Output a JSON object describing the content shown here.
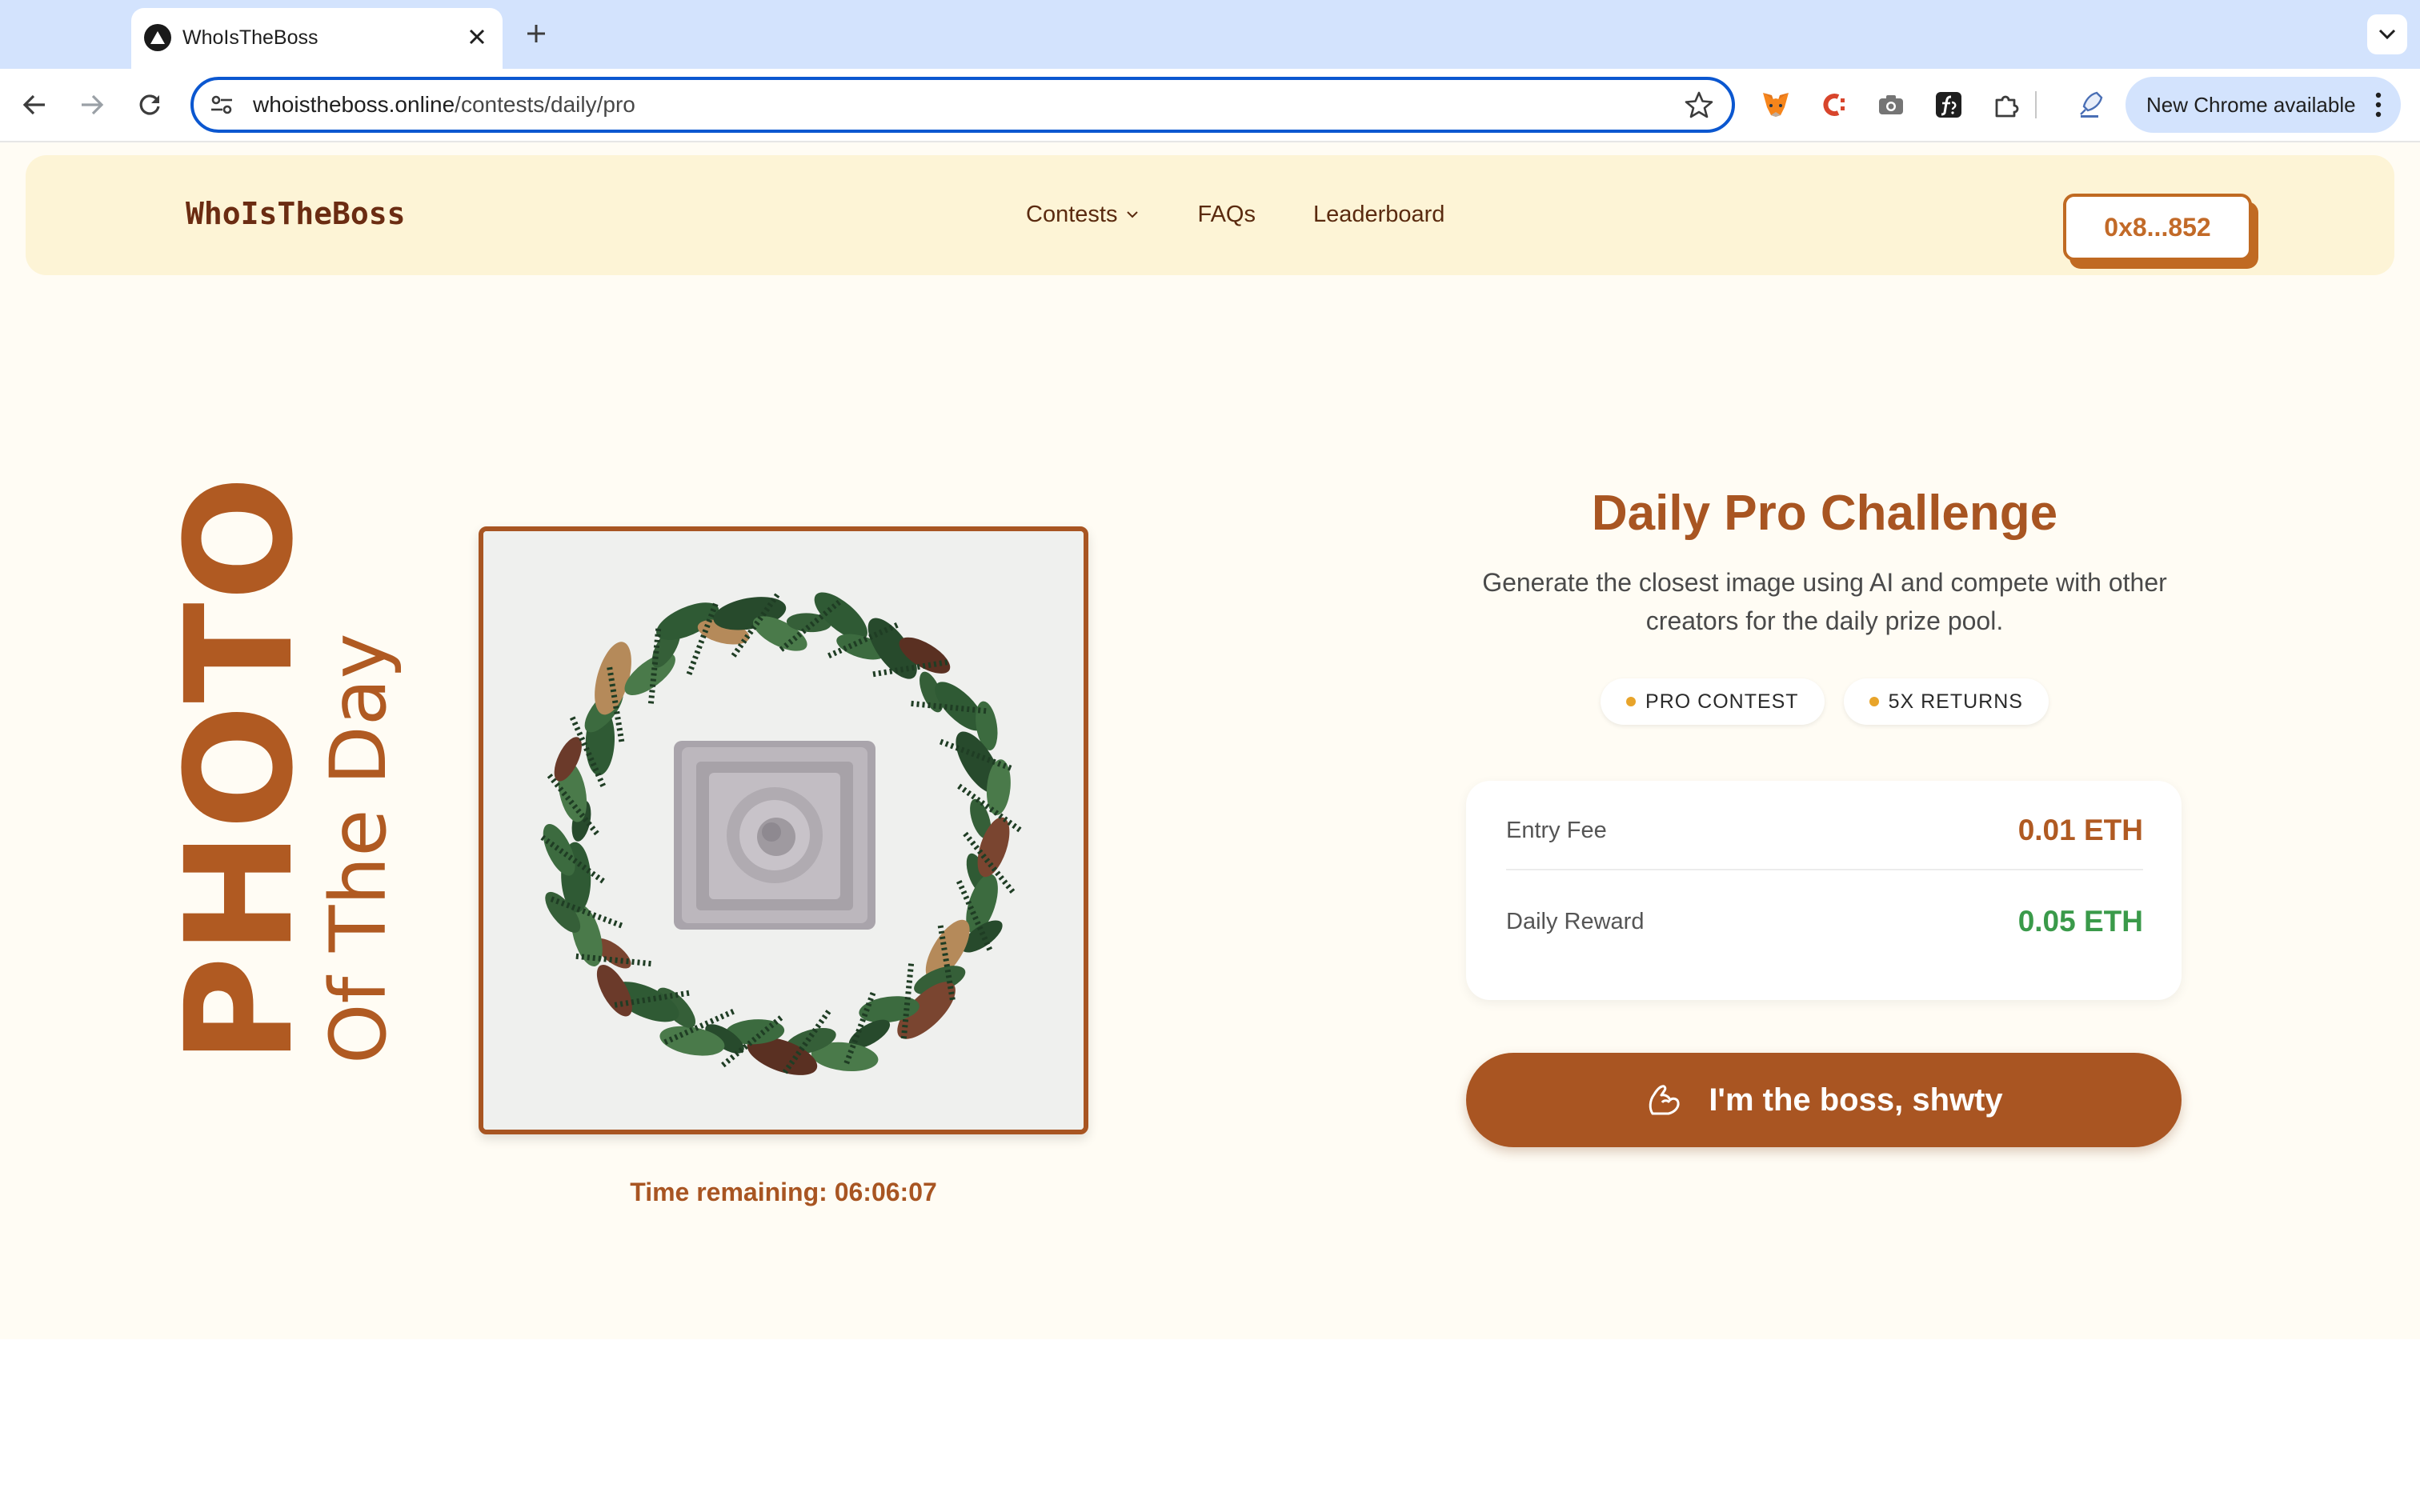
{
  "browser": {
    "tab_title": "WhoIsTheBoss",
    "tab_close_icon": "close-icon",
    "new_tab_icon": "plus-icon",
    "url_host": "whoistheboss.online",
    "url_path": "/contests/daily/pro",
    "update_label": "New Chrome available",
    "extensions": [
      "metamask-fox-icon",
      "c-extension-icon",
      "camera-icon",
      "function-extension-icon",
      "puzzle-piece-icon",
      "rocket-extension-icon"
    ]
  },
  "site": {
    "brand": "WhoIsTheBoss",
    "nav": {
      "contests": "Contests",
      "faqs": "FAQs",
      "leaderboard": "Leaderboard"
    },
    "wallet": "0x8...852"
  },
  "hero": {
    "photo_word": "PHOTO",
    "of_the_day": "Of The Day",
    "timer": "Time remaining: 06:06:07",
    "title": "Daily Pro Challenge",
    "description": "Generate the closest image using AI and compete with other creators for the daily prize pool.",
    "pills": [
      "PRO CONTEST",
      "5X RETURNS"
    ],
    "entry_fee_label": "Entry Fee",
    "entry_fee_value": "0.01 ETH",
    "reward_label": "Daily Reward",
    "reward_value": "0.05 ETH",
    "cta_label": "I'm the boss, shwty"
  },
  "colors": {
    "brand": "#a85522",
    "fee_value": "#b05a22",
    "reward_value": "#3a9a4a",
    "nav_bg": "#fdf4d6",
    "page_bg": "#fffcf4"
  }
}
